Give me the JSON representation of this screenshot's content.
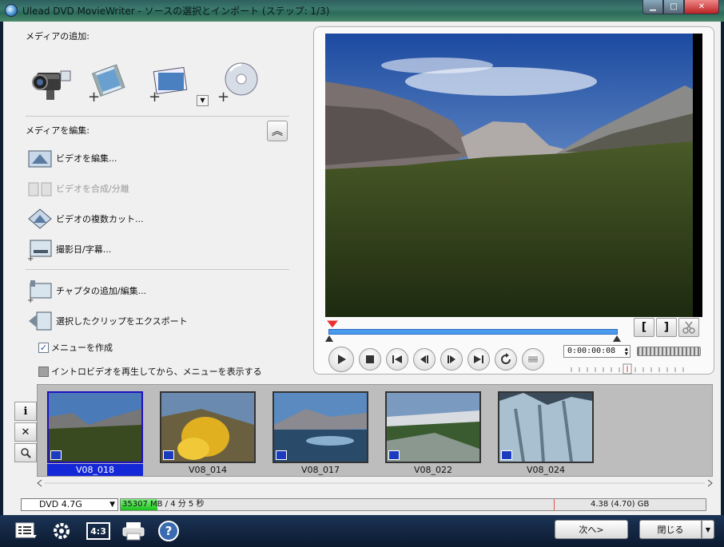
{
  "window": {
    "title": "Ulead DVD MovieWriter - ソースの選択とインポート (ステップ: 1/3)",
    "min_glyph": "▁",
    "max_glyph": "□",
    "close_glyph": "✕"
  },
  "left_panel": {
    "add_media_label": "メディアの追加:",
    "add_media_icons": [
      "camcorder-icon",
      "add-video-icon",
      "add-image-icon",
      "add-disc-icon"
    ],
    "edit_media_label": "メディアを編集:",
    "collapse_glyph": "︽",
    "commands": [
      {
        "label": "ビデオを編集...",
        "enabled": true,
        "icon": "edit-video-icon"
      },
      {
        "label": "ビデオを合成/分離",
        "enabled": false,
        "icon": "merge-split-icon"
      },
      {
        "label": "ビデオの複数カット...",
        "enabled": true,
        "icon": "multi-trim-icon"
      },
      {
        "label": "撮影日/字幕...",
        "enabled": true,
        "icon": "subtitle-icon"
      },
      {
        "label": "チャプタの追加/編集...",
        "enabled": true,
        "icon": "chapter-icon"
      },
      {
        "label": "選択したクリップをエクスポート",
        "enabled": true,
        "icon": "export-icon"
      }
    ],
    "create_menu": {
      "label": "メニューを作成",
      "checked": true
    },
    "intro_video": {
      "label": "イントロビデオを再生してから、メニューを表示する",
      "checked": false
    }
  },
  "preview": {
    "timecode": "0:00:00:08",
    "mark_in_glyph": "[",
    "mark_out_glyph": "]",
    "scrub_position": 0.0
  },
  "clips": {
    "items": [
      {
        "name": "V08_018",
        "selected": true
      },
      {
        "name": "V08_014",
        "selected": false
      },
      {
        "name": "V08_017",
        "selected": false
      },
      {
        "name": "V08_022",
        "selected": false
      },
      {
        "name": "V08_024",
        "selected": false
      }
    ],
    "side_buttons": [
      "i",
      "✕",
      "🔍"
    ]
  },
  "status": {
    "disc_type": "DVD 4.7G",
    "used": "35307 MB / 4 分 5 秒",
    "capacity": "4.38 (4.70) GB",
    "used_fraction": 0.008
  },
  "bottom": {
    "aspect_label": "4:3",
    "help_glyph": "?",
    "next_label": "次へ>",
    "close_label": "閉じる",
    "dropdown_glyph": "▼"
  },
  "colors": {
    "accent": "#1428d8",
    "track": "#4a9aee",
    "capacity_fill": "#1cc01c"
  }
}
